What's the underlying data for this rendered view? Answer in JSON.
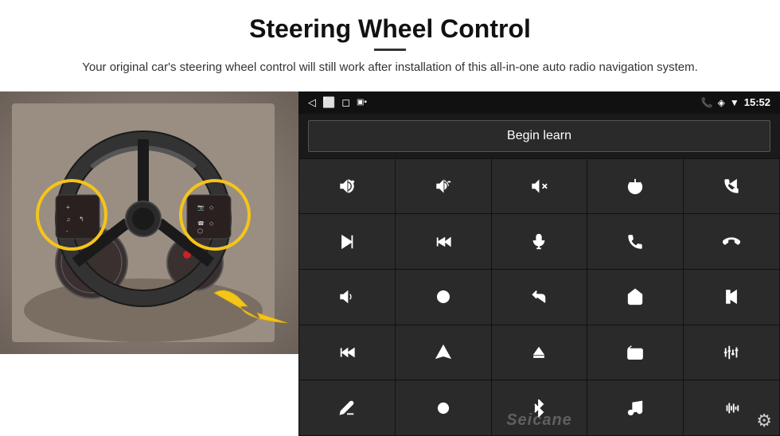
{
  "header": {
    "title": "Steering Wheel Control",
    "divider": true,
    "subtitle": "Your original car's steering wheel control will still work after installation of this all-in-one auto radio navigation system."
  },
  "android_ui": {
    "status_bar": {
      "back_icon": "◁",
      "home_icon": "⬜",
      "recent_icon": "◻",
      "signal_icon": "▣▪",
      "phone_icon": "📞",
      "location_icon": "⬦",
      "wifi_icon": "▼",
      "time": "15:52"
    },
    "begin_learn_label": "Begin learn",
    "watermark": "Seicane",
    "gear_icon": "⚙"
  },
  "controls": [
    {
      "icon": "vol_up",
      "row": 1,
      "col": 1
    },
    {
      "icon": "vol_down",
      "row": 1,
      "col": 2
    },
    {
      "icon": "mute",
      "row": 1,
      "col": 3
    },
    {
      "icon": "power",
      "row": 1,
      "col": 4
    },
    {
      "icon": "phone_prev",
      "row": 1,
      "col": 5
    },
    {
      "icon": "next",
      "row": 2,
      "col": 1
    },
    {
      "icon": "ff_next",
      "row": 2,
      "col": 2
    },
    {
      "icon": "mic",
      "row": 2,
      "col": 3
    },
    {
      "icon": "call",
      "row": 2,
      "col": 4
    },
    {
      "icon": "end_call",
      "row": 2,
      "col": 5
    },
    {
      "icon": "horn",
      "row": 3,
      "col": 1
    },
    {
      "icon": "360_cam",
      "row": 3,
      "col": 2
    },
    {
      "icon": "back",
      "row": 3,
      "col": 3
    },
    {
      "icon": "home",
      "row": 3,
      "col": 4
    },
    {
      "icon": "prev_track",
      "row": 3,
      "col": 5
    },
    {
      "icon": "ff",
      "row": 4,
      "col": 1
    },
    {
      "icon": "nav",
      "row": 4,
      "col": 2
    },
    {
      "icon": "eject",
      "row": 4,
      "col": 3
    },
    {
      "icon": "radio",
      "row": 4,
      "col": 4
    },
    {
      "icon": "eq",
      "row": 4,
      "col": 5
    },
    {
      "icon": "pen",
      "row": 5,
      "col": 1
    },
    {
      "icon": "360_small",
      "row": 5,
      "col": 2
    },
    {
      "icon": "bluetooth",
      "row": 5,
      "col": 3
    },
    {
      "icon": "music",
      "row": 5,
      "col": 4
    },
    {
      "icon": "waveform",
      "row": 5,
      "col": 5
    }
  ]
}
